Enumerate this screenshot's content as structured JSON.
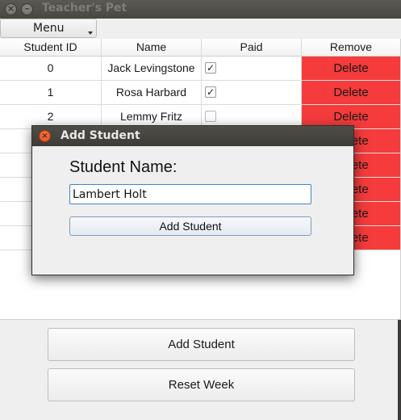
{
  "window": {
    "title": "Teacher's Pet",
    "close_glyph": "×",
    "minimize_glyph": "–"
  },
  "menubar": {
    "menu_label": "Menu"
  },
  "table": {
    "headers": [
      "Student ID",
      "Name",
      "Paid",
      "Remove"
    ],
    "rows": [
      {
        "id": "0",
        "name": "Jack Levingstone",
        "paid": true,
        "remove": "Delete"
      },
      {
        "id": "1",
        "name": "Rosa Harbard",
        "paid": true,
        "remove": "Delete"
      },
      {
        "id": "2",
        "name": "Lemmy Fritz",
        "paid": false,
        "remove": "Delete"
      },
      {
        "remove": "Delete"
      },
      {
        "remove": "Delete"
      },
      {
        "remove": "Delete"
      },
      {
        "remove": "Delete"
      },
      {
        "remove": "Delete"
      }
    ],
    "checkmark_glyph": "✓",
    "remove_color": "#f53b3b"
  },
  "buttons": {
    "add_student": "Add Student",
    "reset_week": "Reset Week"
  },
  "dialog": {
    "title": "Add Student",
    "close_glyph": "×",
    "field_label": "Student Name:",
    "field_value": "Lambert Holt",
    "submit_label": "Add Student",
    "focus_color": "#3f86c4"
  }
}
